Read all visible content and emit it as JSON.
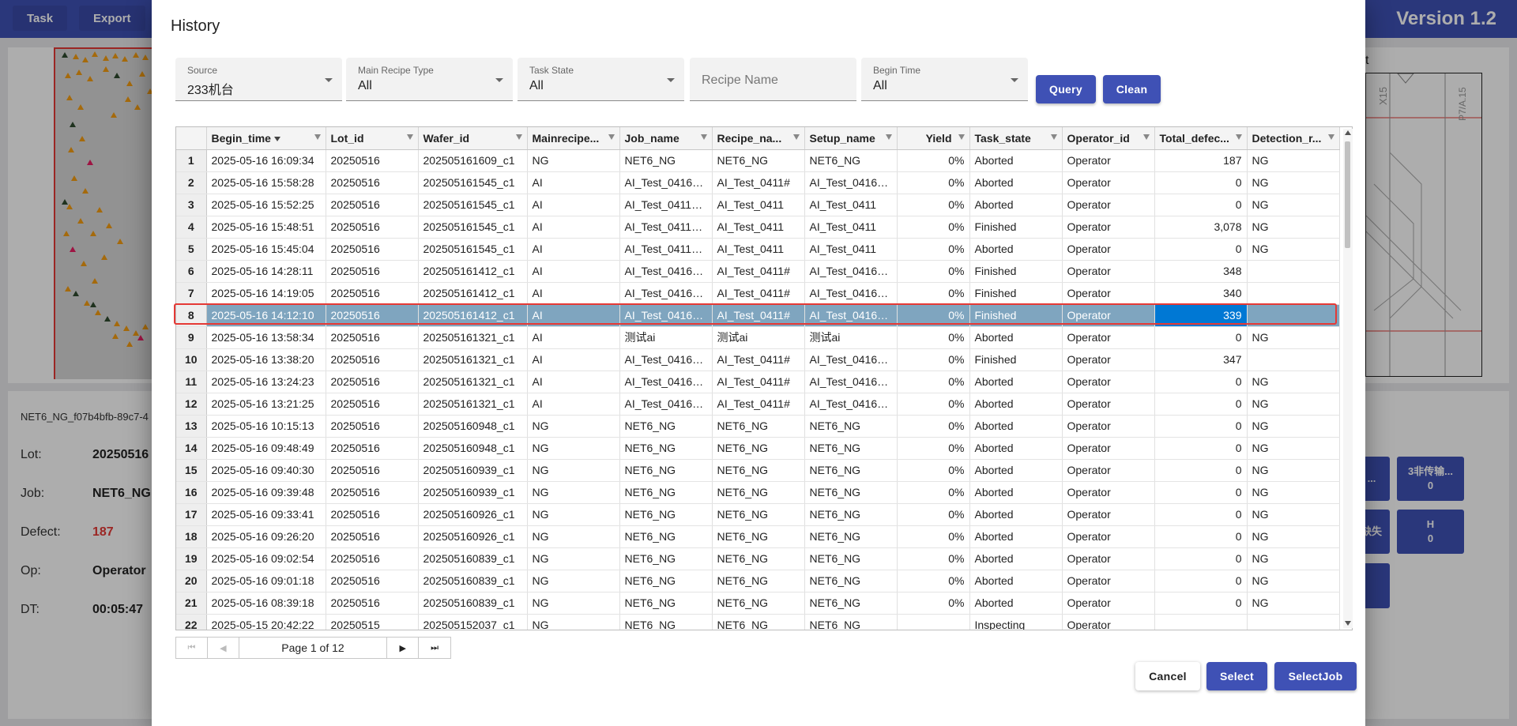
{
  "app": {
    "version": "Version 1.2",
    "top_buttons": [
      "Task",
      "Export"
    ],
    "info": {
      "job_id_prefix": "NET6_NG_f07b4bfb-89c7-4",
      "rows": [
        {
          "label": "Lot:",
          "value": "20250516"
        },
        {
          "label": "Job:",
          "value": "NET6_NG"
        },
        {
          "label": "Defect:",
          "value": "187"
        },
        {
          "label": "Op:",
          "value": "Operator"
        },
        {
          "label": "DT:",
          "value": "00:05:47"
        }
      ]
    },
    "right_partial_title": "t",
    "drawing_labels": [
      "X15",
      "P7/A.15"
    ],
    "right_buttons": [
      {
        "line1": "...",
        "line2": ""
      },
      {
        "line1": "3非传输...",
        "line2": "0"
      },
      {
        "line1": "缺失",
        "line2": ""
      },
      {
        "line1": "H",
        "line2": "0"
      }
    ],
    "colors": {
      "accent": "#3f51b5",
      "selected_row": "#7fa5bf",
      "active_cell": "#0078d4",
      "defect_red": "#e53935"
    }
  },
  "dialog": {
    "title": "History",
    "filters": {
      "source": {
        "label": "Source",
        "value": "233机台"
      },
      "main_recipe_type": {
        "label": "Main Recipe Type",
        "value": "All"
      },
      "task_state": {
        "label": "Task State",
        "value": "All"
      },
      "recipe_name": {
        "placeholder": "Recipe Name"
      },
      "begin_time": {
        "label": "Begin Time",
        "value": "All"
      }
    },
    "query_label": "Query",
    "clean_label": "Clean",
    "columns": [
      "Begin_time",
      "Lot_id",
      "Wafer_id",
      "Mainrecipe...",
      "Job_name",
      "Recipe_na...",
      "Setup_name",
      "Yield",
      "Task_state",
      "Operator_id",
      "Total_defec...",
      "Detection_r..."
    ],
    "sort_column": "Begin_time",
    "selected_row": 8,
    "rows": [
      [
        "1",
        "2025-05-16 16:09:34",
        "20250516",
        "202505161609_c1",
        "NG",
        "NET6_NG",
        "NET6_NG",
        "NET6_NG",
        "0%",
        "Aborted",
        "Operator",
        "187",
        "NG"
      ],
      [
        "2",
        "2025-05-16 15:58:28",
        "20250516",
        "202505161545_c1",
        "AI",
        "AI_Test_0416_...",
        "AI_Test_0411#",
        "AI_Test_0416_...",
        "0%",
        "Aborted",
        "Operator",
        "0",
        "NG"
      ],
      [
        "3",
        "2025-05-16 15:52:25",
        "20250516",
        "202505161545_c1",
        "AI",
        "AI_Test_0411_...",
        "AI_Test_0411",
        "AI_Test_0411",
        "0%",
        "Aborted",
        "Operator",
        "0",
        "NG"
      ],
      [
        "4",
        "2025-05-16 15:48:51",
        "20250516",
        "202505161545_c1",
        "AI",
        "AI_Test_0411_...",
        "AI_Test_0411",
        "AI_Test_0411",
        "0%",
        "Finished",
        "Operator",
        "3,078",
        "NG"
      ],
      [
        "5",
        "2025-05-16 15:45:04",
        "20250516",
        "202505161545_c1",
        "AI",
        "AI_Test_0411_...",
        "AI_Test_0411",
        "AI_Test_0411",
        "0%",
        "Aborted",
        "Operator",
        "0",
        "NG"
      ],
      [
        "6",
        "2025-05-16 14:28:11",
        "20250516",
        "202505161412_c1",
        "AI",
        "AI_Test_0416_...",
        "AI_Test_0411#",
        "AI_Test_0416_...",
        "0%",
        "Finished",
        "Operator",
        "348",
        ""
      ],
      [
        "7",
        "2025-05-16 14:19:05",
        "20250516",
        "202505161412_c1",
        "AI",
        "AI_Test_0416_...",
        "AI_Test_0411#",
        "AI_Test_0416_...",
        "0%",
        "Finished",
        "Operator",
        "340",
        ""
      ],
      [
        "8",
        "2025-05-16 14:12:10",
        "20250516",
        "202505161412_c1",
        "AI",
        "AI_Test_0416_...",
        "AI_Test_0411#",
        "AI_Test_0416_...",
        "0%",
        "Finished",
        "Operator",
        "339",
        ""
      ],
      [
        "9",
        "2025-05-16 13:58:34",
        "20250516",
        "202505161321_c1",
        "AI",
        "测试ai",
        "测试ai",
        "测试ai",
        "0%",
        "Aborted",
        "Operator",
        "0",
        "NG"
      ],
      [
        "10",
        "2025-05-16 13:38:20",
        "20250516",
        "202505161321_c1",
        "AI",
        "AI_Test_0416_...",
        "AI_Test_0411#",
        "AI_Test_0416_...",
        "0%",
        "Finished",
        "Operator",
        "347",
        ""
      ],
      [
        "11",
        "2025-05-16 13:24:23",
        "20250516",
        "202505161321_c1",
        "AI",
        "AI_Test_0416_...",
        "AI_Test_0411#",
        "AI_Test_0416_...",
        "0%",
        "Aborted",
        "Operator",
        "0",
        "NG"
      ],
      [
        "12",
        "2025-05-16 13:21:25",
        "20250516",
        "202505161321_c1",
        "AI",
        "AI_Test_0416_...",
        "AI_Test_0411#",
        "AI_Test_0416_...",
        "0%",
        "Aborted",
        "Operator",
        "0",
        "NG"
      ],
      [
        "13",
        "2025-05-16 10:15:13",
        "20250516",
        "202505160948_c1",
        "NG",
        "NET6_NG",
        "NET6_NG",
        "NET6_NG",
        "0%",
        "Aborted",
        "Operator",
        "0",
        "NG"
      ],
      [
        "14",
        "2025-05-16 09:48:49",
        "20250516",
        "202505160948_c1",
        "NG",
        "NET6_NG",
        "NET6_NG",
        "NET6_NG",
        "0%",
        "Aborted",
        "Operator",
        "0",
        "NG"
      ],
      [
        "15",
        "2025-05-16 09:40:30",
        "20250516",
        "202505160939_c1",
        "NG",
        "NET6_NG",
        "NET6_NG",
        "NET6_NG",
        "0%",
        "Aborted",
        "Operator",
        "0",
        "NG"
      ],
      [
        "16",
        "2025-05-16 09:39:48",
        "20250516",
        "202505160939_c1",
        "NG",
        "NET6_NG",
        "NET6_NG",
        "NET6_NG",
        "0%",
        "Aborted",
        "Operator",
        "0",
        "NG"
      ],
      [
        "17",
        "2025-05-16 09:33:41",
        "20250516",
        "202505160926_c1",
        "NG",
        "NET6_NG",
        "NET6_NG",
        "NET6_NG",
        "0%",
        "Aborted",
        "Operator",
        "0",
        "NG"
      ],
      [
        "18",
        "2025-05-16 09:26:20",
        "20250516",
        "202505160926_c1",
        "NG",
        "NET6_NG",
        "NET6_NG",
        "NET6_NG",
        "0%",
        "Aborted",
        "Operator",
        "0",
        "NG"
      ],
      [
        "19",
        "2025-05-16 09:02:54",
        "20250516",
        "202505160839_c1",
        "NG",
        "NET6_NG",
        "NET6_NG",
        "NET6_NG",
        "0%",
        "Aborted",
        "Operator",
        "0",
        "NG"
      ],
      [
        "20",
        "2025-05-16 09:01:18",
        "20250516",
        "202505160839_c1",
        "NG",
        "NET6_NG",
        "NET6_NG",
        "NET6_NG",
        "0%",
        "Aborted",
        "Operator",
        "0",
        "NG"
      ],
      [
        "21",
        "2025-05-16 08:39:18",
        "20250516",
        "202505160839_c1",
        "NG",
        "NET6_NG",
        "NET6_NG",
        "NET6_NG",
        "0%",
        "Aborted",
        "Operator",
        "0",
        "NG"
      ],
      [
        "22",
        "2025-05-15 20:42:22",
        "20250515",
        "202505152037_c1",
        "NG",
        "NET6_NG",
        "NET6_NG",
        "NET6_NG",
        "",
        "Inspecting",
        "Operator",
        "",
        ""
      ]
    ],
    "pager": {
      "text": "Page 1 of 12"
    },
    "cancel_label": "Cancel",
    "select_label": "Select",
    "selectjob_label": "SelectJob"
  }
}
